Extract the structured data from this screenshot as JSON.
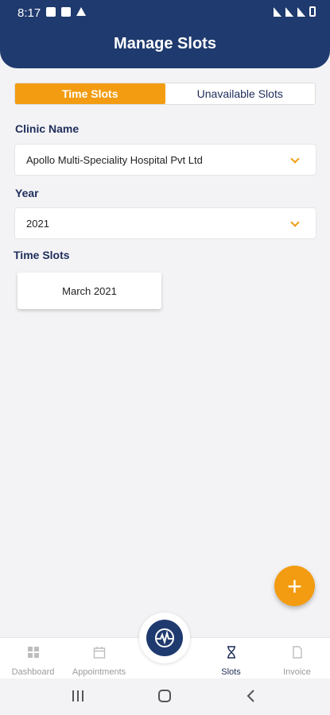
{
  "status_bar": {
    "time": "8:17"
  },
  "header": {
    "title": "Manage Slots"
  },
  "tabs": [
    {
      "label": "Time Slots",
      "active": true
    },
    {
      "label": "Unavailable Slots",
      "active": false
    }
  ],
  "clinic": {
    "label": "Clinic Name",
    "value": "Apollo Multi-Speciality Hospital Pvt Ltd"
  },
  "year": {
    "label": "Year",
    "value": "2021"
  },
  "time_slots": {
    "label": "Time Slots",
    "items": [
      "March 2021"
    ]
  },
  "fab": {
    "label": "+"
  },
  "bottom_nav": [
    {
      "label": "Dashboard",
      "icon": "grid-icon",
      "active": false
    },
    {
      "label": "Appointments",
      "icon": "calendar-icon",
      "active": false
    },
    {
      "label": "Slots",
      "icon": "hourglass-icon",
      "active": true
    },
    {
      "label": "Invoice",
      "icon": "document-icon",
      "active": false
    }
  ],
  "colors": {
    "primary": "#1f3a6e",
    "accent": "#f39c12"
  }
}
